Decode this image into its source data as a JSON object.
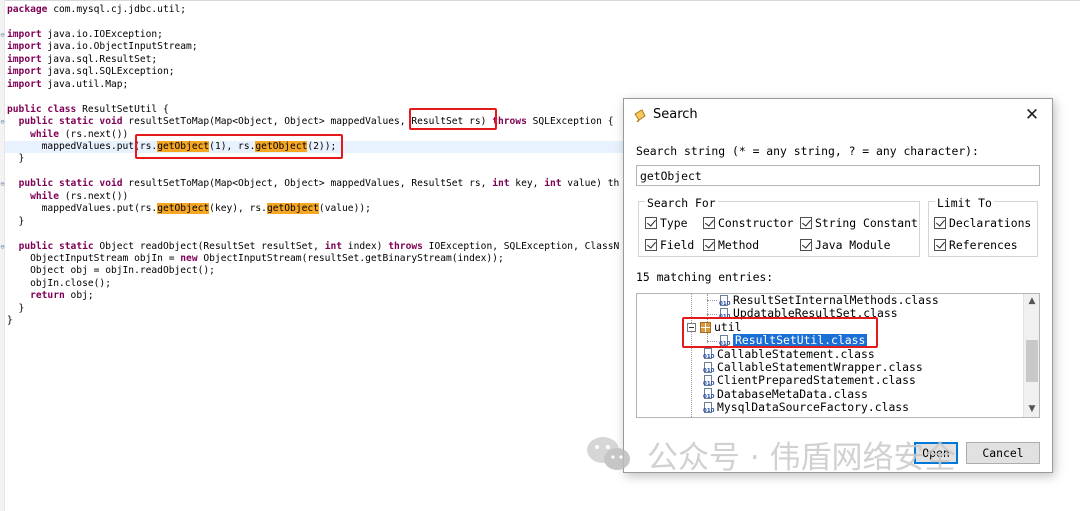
{
  "editor": {
    "lines": [
      {
        "segments": [
          {
            "t": "package",
            "kw": true
          },
          {
            "t": " com.mysql.cj.jdbc.util;"
          }
        ]
      },
      {
        "segments": []
      },
      {
        "segments": [
          {
            "t": "import",
            "kw": true
          },
          {
            "t": " java.io.IOException;"
          }
        ],
        "fold": "⊖"
      },
      {
        "segments": [
          {
            "t": "import",
            "kw": true
          },
          {
            "t": " java.io.ObjectInputStream;"
          }
        ]
      },
      {
        "segments": [
          {
            "t": "import",
            "kw": true
          },
          {
            "t": " java.sql.ResultSet;"
          }
        ]
      },
      {
        "segments": [
          {
            "t": "import",
            "kw": true
          },
          {
            "t": " java.sql.SQLException;"
          }
        ]
      },
      {
        "segments": [
          {
            "t": "import",
            "kw": true
          },
          {
            "t": " java.util.Map;"
          }
        ]
      },
      {
        "segments": []
      },
      {
        "segments": [
          {
            "t": "public class",
            "kw": true
          },
          {
            "t": " ResultSetUtil {"
          }
        ]
      },
      {
        "segments": [
          {
            "t": "  "
          },
          {
            "t": "public static void",
            "kw": true
          },
          {
            "t": " resultSetToMap(Map<Object, Object> mappedValues, ResultSet rs) "
          },
          {
            "t": "throws",
            "kw": true
          },
          {
            "t": " SQLException {"
          }
        ],
        "fold": "⊖"
      },
      {
        "segments": [
          {
            "t": "    "
          },
          {
            "t": "while",
            "kw": true
          },
          {
            "t": " (rs.next())"
          }
        ]
      },
      {
        "segments": [
          {
            "t": "      mappedValues.put(rs."
          },
          {
            "t": "getObject",
            "hl": true
          },
          {
            "t": "(1), rs."
          },
          {
            "t": "getObject",
            "hl": true
          },
          {
            "t": "(2));"
          }
        ],
        "current": true
      },
      {
        "segments": [
          {
            "t": "  }"
          }
        ]
      },
      {
        "segments": []
      },
      {
        "segments": [
          {
            "t": "  "
          },
          {
            "t": "public static void",
            "kw": true
          },
          {
            "t": " resultSetToMap(Map<Object, Object> mappedValues, ResultSet rs, "
          },
          {
            "t": "int",
            "kw": true
          },
          {
            "t": " key, "
          },
          {
            "t": "int",
            "kw": true
          },
          {
            "t": " value) th"
          }
        ],
        "fold": "⊖"
      },
      {
        "segments": [
          {
            "t": "    "
          },
          {
            "t": "while",
            "kw": true
          },
          {
            "t": " (rs.next())"
          }
        ]
      },
      {
        "segments": [
          {
            "t": "      mappedValues.put(rs."
          },
          {
            "t": "getObject",
            "hl": true
          },
          {
            "t": "(key), rs."
          },
          {
            "t": "getObject",
            "hl": true
          },
          {
            "t": "(value));"
          }
        ]
      },
      {
        "segments": [
          {
            "t": "  }"
          }
        ]
      },
      {
        "segments": []
      },
      {
        "segments": [
          {
            "t": "  "
          },
          {
            "t": "public static",
            "kw": true
          },
          {
            "t": " Object readObject(ResultSet resultSet, "
          },
          {
            "t": "int",
            "kw": true
          },
          {
            "t": " index) "
          },
          {
            "t": "throws",
            "kw": true
          },
          {
            "t": " IOException, SQLException, ClassN"
          }
        ],
        "fold": "⊖"
      },
      {
        "segments": [
          {
            "t": "    ObjectInputStream objIn = "
          },
          {
            "t": "new",
            "kw": true
          },
          {
            "t": " ObjectInputStream(resultSet.getBinaryStream(index));"
          }
        ]
      },
      {
        "segments": [
          {
            "t": "    Object obj = objIn.readObject();"
          }
        ]
      },
      {
        "segments": [
          {
            "t": "    objIn.close();"
          }
        ]
      },
      {
        "segments": [
          {
            "t": "    "
          },
          {
            "t": "return",
            "kw": true
          },
          {
            "t": " obj;"
          }
        ]
      },
      {
        "segments": [
          {
            "t": "  }"
          }
        ]
      },
      {
        "segments": [
          {
            "t": "}"
          }
        ]
      }
    ]
  },
  "dialog": {
    "title": "Search",
    "close_symbol": "✕",
    "search_label": "Search string (* = any string, ? = any character):",
    "search_value": "getObject",
    "search_for": {
      "title": "Search For",
      "options": [
        "Type",
        "Constructor",
        "String Constant",
        "Field",
        "Method",
        "Java Module"
      ]
    },
    "limit_to": {
      "title": "Limit To",
      "options": [
        "Declarations",
        "References"
      ]
    },
    "matches_label": "15 matching entries:",
    "tree": [
      {
        "label": "ResultSetInternalMethods.class",
        "kind": "class",
        "indent": 82
      },
      {
        "label": "UpdatableResultSet.class",
        "kind": "class",
        "indent": 82
      },
      {
        "label": "util",
        "kind": "package",
        "indent": 50
      },
      {
        "label": "ResultSetUtil.class",
        "kind": "class",
        "indent": 82,
        "selected": true
      },
      {
        "label": "CallableStatement.class",
        "kind": "class",
        "indent": 66
      },
      {
        "label": "CallableStatementWrapper.class",
        "kind": "class",
        "indent": 66
      },
      {
        "label": "ClientPreparedStatement.class",
        "kind": "class",
        "indent": 66
      },
      {
        "label": "DatabaseMetaData.class",
        "kind": "class",
        "indent": 66
      },
      {
        "label": "MysqlDataSourceFactory.class",
        "kind": "class",
        "indent": 66
      }
    ],
    "buttons": {
      "open": "Open",
      "cancel": "Cancel"
    }
  },
  "watermark": {
    "text": "公众号 · 伟盾网络安全"
  },
  "colors": {
    "highlight": "#f5a623",
    "annotation": "#e41a1a",
    "selection": "#1a6fd6",
    "keyword": "#7f0055"
  }
}
